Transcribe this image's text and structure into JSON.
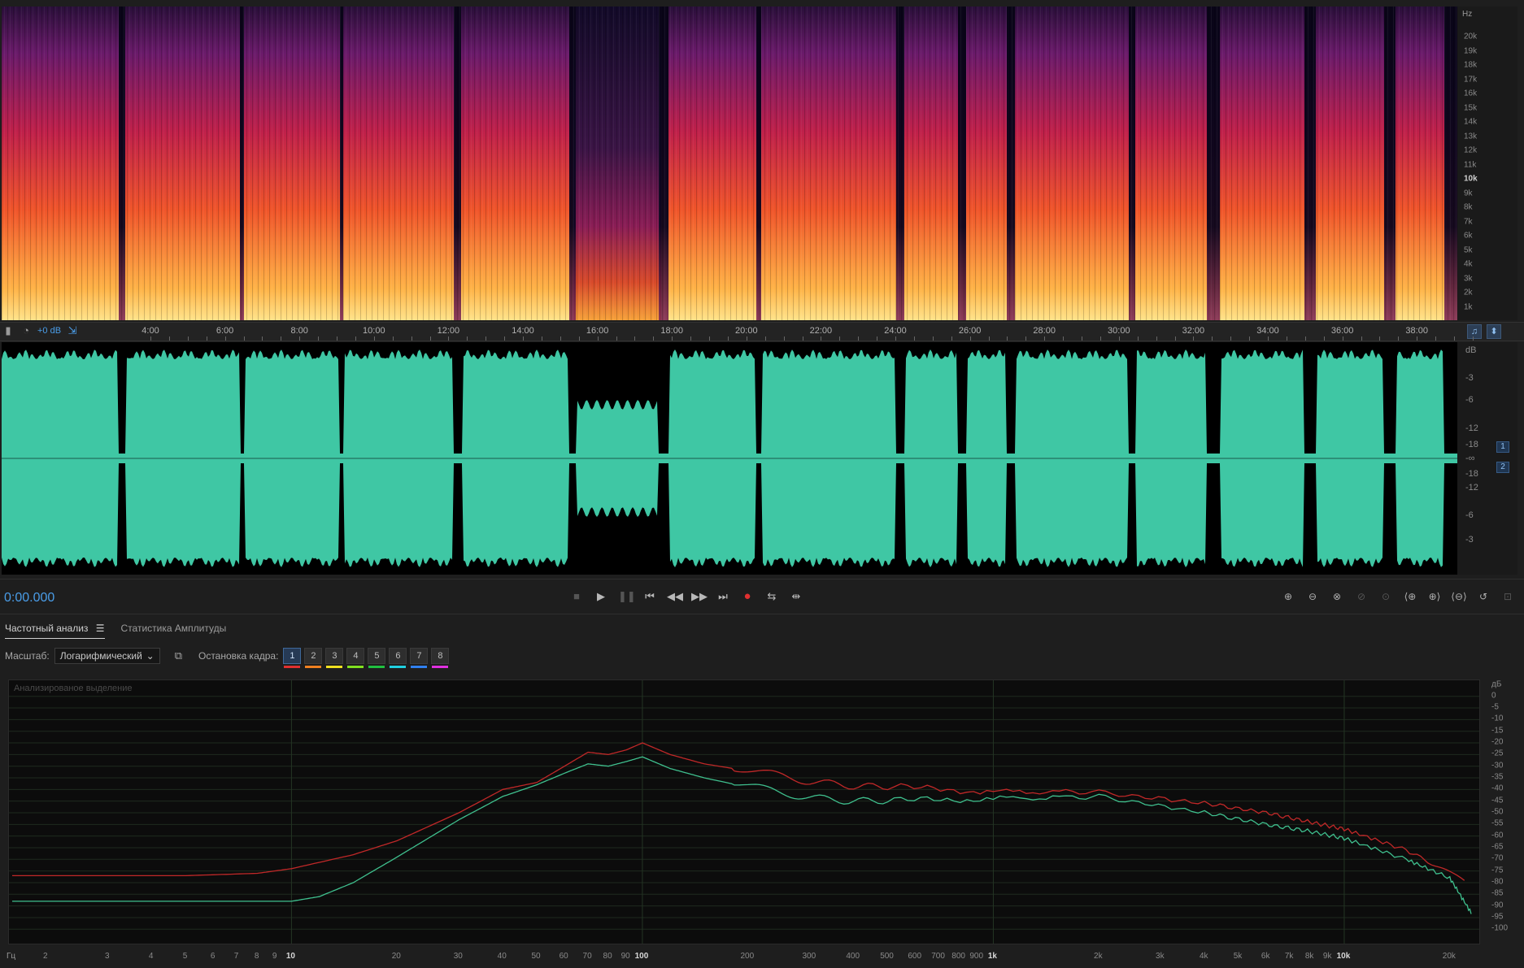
{
  "spectrogram": {
    "hz_unit": "Hz",
    "hz_ticks": [
      "20k",
      "19k",
      "18k",
      "17k",
      "16k",
      "15k",
      "14k",
      "13k",
      "12k",
      "11k",
      "10k",
      "9k",
      "8k",
      "7k",
      "6k",
      "5k",
      "4k",
      "3k",
      "2k",
      "1k"
    ]
  },
  "time_ruler": {
    "gain": "+0 dB",
    "labels": [
      "4:00",
      "6:00",
      "8:00",
      "10:00",
      "12:00",
      "14:00",
      "16:00",
      "18:00",
      "20:00",
      "22:00",
      "24:00",
      "26:00",
      "28:00",
      "30:00",
      "32:00",
      "34:00",
      "36:00",
      "38:00"
    ]
  },
  "waveform": {
    "db_unit": "dB",
    "db_ticks_top": [
      "-3",
      "-6",
      "-12",
      "-18",
      "-∞"
    ],
    "db_ticks_bottom": [
      "-18",
      "-12",
      "-6",
      "-3"
    ],
    "channels": [
      "1",
      "2"
    ]
  },
  "transport": {
    "time": "0:00.000"
  },
  "analysis": {
    "tabs": [
      {
        "label": "Частотный анализ",
        "active": true
      },
      {
        "label": "Статистика Амплитуды",
        "active": false
      }
    ],
    "scale_label": "Масштаб:",
    "scale_value": "Логарифмический",
    "freeze_label": "Остановка кадра:",
    "frames": [
      {
        "n": "1",
        "color": "#e03030"
      },
      {
        "n": "2",
        "color": "#f08020"
      },
      {
        "n": "3",
        "color": "#f0e020"
      },
      {
        "n": "4",
        "color": "#80e020"
      },
      {
        "n": "5",
        "color": "#20c040"
      },
      {
        "n": "6",
        "color": "#20d0e0"
      },
      {
        "n": "7",
        "color": "#3080f0"
      },
      {
        "n": "8",
        "color": "#e030e0"
      }
    ],
    "graph_label": "Анализированое выделение",
    "db_unit": "дБ",
    "db_ticks": [
      "0",
      "-5",
      "-10",
      "-15",
      "-20",
      "-25",
      "-30",
      "-35",
      "-40",
      "-45",
      "-50",
      "-55",
      "-60",
      "-65",
      "-70",
      "-75",
      "-80",
      "-85",
      "-90",
      "-95",
      "-100"
    ],
    "freq_unit": "Гц",
    "freq_labels": [
      "2",
      "3",
      "4",
      "5",
      "6",
      "7",
      "8",
      "9",
      "10",
      "20",
      "30",
      "40",
      "50",
      "60",
      "70",
      "80",
      "90",
      "100",
      "200",
      "300",
      "400",
      "500",
      "600",
      "700",
      "800",
      "900",
      "1k",
      "2k",
      "3k",
      "4k",
      "5k",
      "6k",
      "7k",
      "8k",
      "9k",
      "10k",
      "20k"
    ],
    "chart_data": {
      "type": "line",
      "xscale": "log",
      "xlim": [
        1.6,
        24000
      ],
      "ylim": [
        -102,
        2
      ],
      "series": [
        {
          "color": "#c02828",
          "x": [
            1.6,
            5,
            8,
            10,
            15,
            20,
            30,
            40,
            50,
            60,
            70,
            80,
            90,
            100,
            120,
            150,
            200,
            300,
            500,
            1000,
            2000,
            4000,
            6000,
            8000,
            10000,
            15000,
            22000
          ],
          "y": [
            -77,
            -77,
            -76,
            -74,
            -68,
            -62,
            -50,
            -40,
            -37,
            -30,
            -24,
            -25,
            -23,
            -20,
            -25,
            -29,
            -32,
            -36,
            -39,
            -41,
            -41,
            -46,
            -50,
            -54,
            -57,
            -66,
            -79
          ]
        },
        {
          "color": "#3fc08e",
          "x": [
            1.6,
            5,
            8,
            10,
            12,
            15,
            20,
            30,
            40,
            50,
            60,
            70,
            80,
            90,
            100,
            120,
            150,
            200,
            300,
            500,
            1000,
            2000,
            4000,
            6000,
            8000,
            10000,
            15000,
            20000,
            23000
          ],
          "y": [
            -88,
            -88,
            -88,
            -88,
            -86,
            -80,
            -69,
            -53,
            -43,
            -38,
            -33,
            -29,
            -30,
            -28,
            -26,
            -31,
            -35,
            -39,
            -43,
            -45,
            -44,
            -43,
            -50,
            -55,
            -58,
            -61,
            -70,
            -78,
            -93
          ]
        }
      ]
    }
  }
}
